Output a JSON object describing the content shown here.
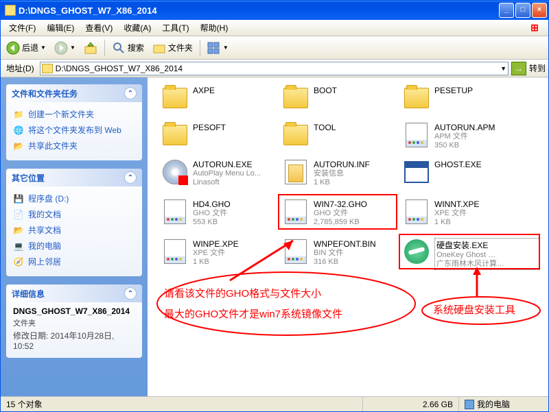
{
  "title": "D:\\DNGS_GHOST_W7_X86_2014",
  "menu": {
    "file": "文件(F)",
    "edit": "编辑(E)",
    "view": "查看(V)",
    "fav": "收藏(A)",
    "tools": "工具(T)",
    "help": "帮助(H)"
  },
  "toolbar": {
    "back": "后退",
    "search": "搜索",
    "folders": "文件夹"
  },
  "address": {
    "label": "地址(D)",
    "path": "D:\\DNGS_GHOST_W7_X86_2014",
    "go": "转到"
  },
  "panels": {
    "tasks": {
      "title": "文件和文件夹任务",
      "items": [
        {
          "icon": "📁",
          "label": "创建一个新文件夹"
        },
        {
          "icon": "🌐",
          "label": "将这个文件夹发布到 Web"
        },
        {
          "icon": "📂",
          "label": "共享此文件夹"
        }
      ]
    },
    "places": {
      "title": "其它位置",
      "items": [
        {
          "icon": "💾",
          "label": "程序盘 (D:)"
        },
        {
          "icon": "📄",
          "label": "我的文档"
        },
        {
          "icon": "📂",
          "label": "共享文档"
        },
        {
          "icon": "💻",
          "label": "我的电脑"
        },
        {
          "icon": "🧭",
          "label": "网上邻居"
        }
      ]
    },
    "details": {
      "title": "详细信息",
      "name": "DNGS_GHOST_W7_X86_2014",
      "type": "文件夹",
      "date_label": "修改日期: ",
      "date": "2014年10月28日, 10:52"
    }
  },
  "files": [
    {
      "name": "AXPE",
      "type": "folder",
      "col": 0,
      "row": 0
    },
    {
      "name": "BOOT",
      "type": "folder",
      "col": 1,
      "row": 0
    },
    {
      "name": "PESETUP",
      "type": "folder",
      "col": 2,
      "row": 0
    },
    {
      "name": "PESOFT",
      "type": "folder",
      "col": 0,
      "row": 1
    },
    {
      "name": "TOOL",
      "type": "folder",
      "col": 1,
      "row": 1
    },
    {
      "name": "AUTORUN.APM",
      "type": "doc",
      "meta1": "APM 文件",
      "meta2": "350 KB",
      "col": 2,
      "row": 1
    },
    {
      "name": "AUTORUN.EXE",
      "type": "cd",
      "meta1": "AutoPlay Menu Lo...",
      "meta2": "Linasoft",
      "col": 0,
      "row": 2
    },
    {
      "name": "AUTORUN.INF",
      "type": "inf",
      "meta1": "安装信息",
      "meta2": "1 KB",
      "col": 1,
      "row": 2
    },
    {
      "name": "GHOST.EXE",
      "type": "exe",
      "col": 2,
      "row": 2
    },
    {
      "name": "HD4.GHO",
      "type": "doc",
      "meta1": "GHO 文件",
      "meta2": "553 KB",
      "col": 0,
      "row": 3
    },
    {
      "name": "WIN7-32.GHO",
      "type": "doc",
      "meta1": "GHO 文件",
      "meta2": "2,785,859 KB",
      "col": 1,
      "row": 3,
      "boxed": true
    },
    {
      "name": "WINNT.XPE",
      "type": "doc",
      "meta1": "XPE 文件",
      "meta2": "1 KB",
      "col": 2,
      "row": 3
    },
    {
      "name": "WINPE.XPE",
      "type": "doc",
      "meta1": "XPE 文件",
      "meta2": "1 KB",
      "col": 0,
      "row": 4
    },
    {
      "name": "WNPEFONT.BIN",
      "type": "doc",
      "meta1": "BIN 文件",
      "meta2": "316 KB",
      "col": 1,
      "row": 4
    },
    {
      "name": "硬盘安装.EXE",
      "type": "green",
      "meta1": "OneKey Ghost …",
      "meta2": "广东雨林木风计算…",
      "col": 2,
      "row": 4,
      "selected": true,
      "boxed": true,
      "wide": true
    }
  ],
  "annot": {
    "line1": "请看该文件的GHO格式与文件大小",
    "line2": "最大的GHO文件才是win7系统镜像文件",
    "right": "系统硬盘安装工具"
  },
  "status": {
    "count": "15 个对象",
    "size": "2.66 GB",
    "loc": "我的电脑"
  }
}
